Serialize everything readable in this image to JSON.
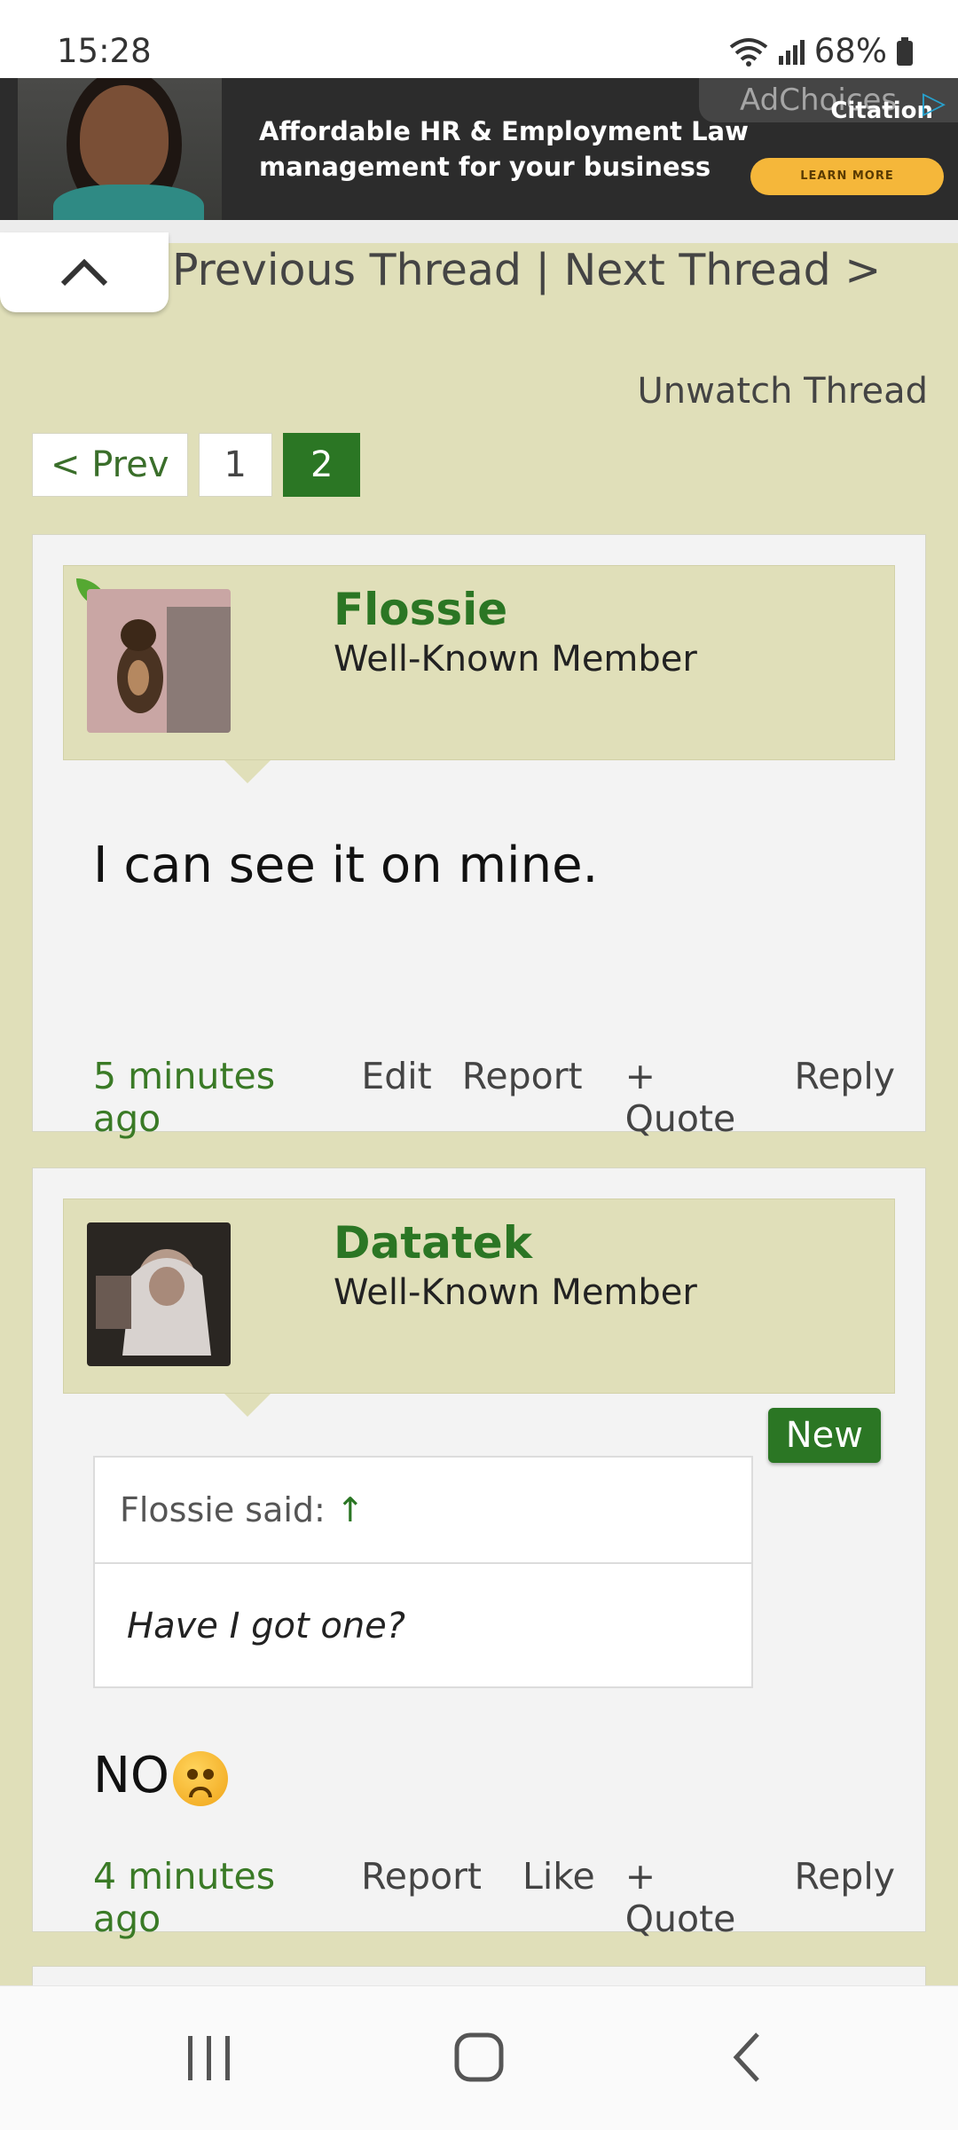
{
  "status": {
    "time": "15:28",
    "battery": "68%"
  },
  "ad": {
    "line1": "Affordable HR & Employment Law",
    "line2": "management for your business",
    "cta": "LEARN MORE",
    "adchoices": "AdChoices",
    "brand": "Citation"
  },
  "nav": {
    "thread_nav": "Previous Thread | Next Thread >",
    "unwatch": "Unwatch Thread"
  },
  "pager": {
    "prev": "< Prev",
    "page1": "1",
    "page2": "2"
  },
  "posts": [
    {
      "username": "Flossie",
      "role": "Well-Known Member",
      "message": "I can see it on mine.",
      "time": "5 minutes ago",
      "actions": [
        "Edit",
        "Report",
        "+ Quote",
        "Reply"
      ]
    },
    {
      "username": "Datatek",
      "role": "Well-Known Member",
      "badge": "New",
      "quote_author": "Flossie said:",
      "quote_arrow": "↑",
      "quote_text": "Have I got one?",
      "message": "NO",
      "time": "4 minutes ago",
      "actions": [
        "Report",
        "Like",
        "+ Quote",
        "Reply"
      ]
    }
  ],
  "colors": {
    "background": "#e0dfb9",
    "accent": "#2b7624"
  }
}
